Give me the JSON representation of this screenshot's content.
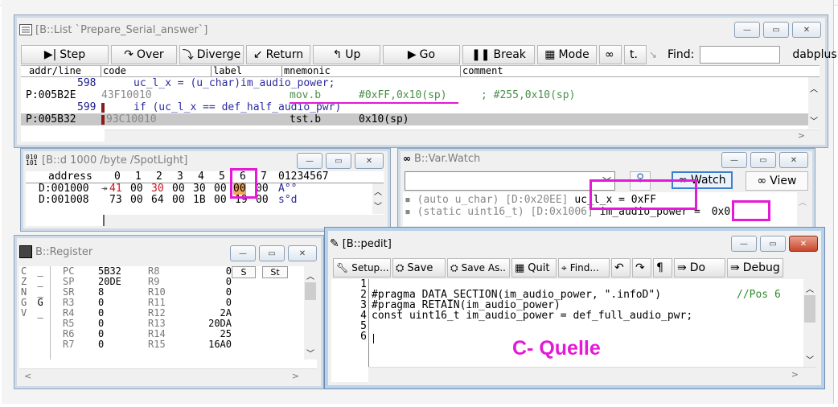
{
  "list_win": {
    "title": "[B::List `Prepare_Serial_answer`]",
    "toolbar": {
      "step": "Step",
      "over": "Over",
      "diverge": "Diverge",
      "return": "Return",
      "up": "Up",
      "go": "Go",
      "break": "Break",
      "mode": "Mode",
      "find_label": "Find:",
      "find_value": "",
      "file": "dabplus.c"
    },
    "columns": {
      "addr": "addr/line",
      "code": "code",
      "label": "label",
      "mnemonic": "mnemonic",
      "comment": "comment"
    },
    "rows": [
      {
        "addr": "598",
        "code": "",
        "src": "uc_l_x = (u_char)im_audio_power;",
        "mnem": "",
        "args": "",
        "comment": ""
      },
      {
        "addr": "P:005B2E",
        "code": "43F10010",
        "src": "",
        "mnem": "mov.b",
        "args": "#0xFF,0x10(sp)",
        "comment": "; #255,0x10(sp)"
      },
      {
        "addr": "599",
        "code": "",
        "src": "if (uc_l_x == def_half_audio_pwr)",
        "mnem": "",
        "args": "",
        "comment": ""
      },
      {
        "addr": "P:005B32",
        "code": "93C10010",
        "src": "",
        "mnem": "tst.b",
        "args": "0x10(sp)",
        "comment": ""
      }
    ]
  },
  "dump_win": {
    "title": "[B::d 1000 /byte /SpotLight]",
    "header": {
      "address": "address",
      "cols": [
        "0",
        "1",
        "2",
        "3",
        "4",
        "5",
        "6",
        "7"
      ],
      "ascii": "01234567"
    },
    "rows": [
      {
        "addr": "D:001000",
        "marker": "↠",
        "bytes": [
          "41",
          "00",
          "30",
          "00",
          "30",
          "00",
          "00",
          "00"
        ],
        "ascii": "A°°"
      },
      {
        "addr": "D:001008",
        "marker": "",
        "bytes": [
          "73",
          "00",
          "64",
          "00",
          "1B",
          "00",
          "19",
          "00"
        ],
        "ascii": "s°d"
      }
    ]
  },
  "var_win": {
    "title": "B::Var.Watch",
    "watch_label": "Watch",
    "view_label": "View",
    "lines": [
      {
        "prefix": "(auto u_char) [D:0x20EE]",
        "name": "uc_l_x",
        "value": "uc_l_x = 0xFF"
      },
      {
        "prefix": "(static uint16_t) [D:0x1006]",
        "name": "im_audio_power",
        "value": "im_audio_power = ",
        "val": "0x0"
      }
    ]
  },
  "reg_win": {
    "title": "B::Register",
    "flags": [
      [
        "C",
        "_"
      ],
      [
        "Z",
        "_"
      ],
      [
        "N",
        "_"
      ],
      [
        "G",
        "G"
      ],
      [
        "V",
        "_"
      ],
      [
        "",
        ""
      ],
      [
        "",
        ""
      ],
      [
        "",
        ""
      ]
    ],
    "regs": [
      [
        "PC",
        "5B32",
        "R8",
        "0"
      ],
      [
        "SP",
        "20DE",
        "R9",
        "0"
      ],
      [
        "SR",
        "8",
        "R10",
        "0"
      ],
      [
        "R3",
        "0",
        "R11",
        "0"
      ],
      [
        "R4",
        "0",
        "R12",
        "2A"
      ],
      [
        "R5",
        "0",
        "R13",
        "20DA"
      ],
      [
        "R6",
        "0",
        "R14",
        "25"
      ],
      [
        "R7",
        "0",
        "R15",
        "16A0"
      ]
    ],
    "btn_s": "S",
    "btn_st": "St"
  },
  "pedit_win": {
    "title": "[B::pedit]",
    "toolbar": {
      "setup": "Setup...",
      "save": "Save",
      "save_as": "Save As..",
      "quit": "Quit",
      "find": "Find...",
      "do": "Do",
      "debug": "Debug"
    },
    "lines": [
      {
        "n": "1",
        "text": ""
      },
      {
        "n": "2",
        "text": "#pragma DATA_SECTION(im_audio_power, \".infoD\")",
        "comment": "//Pos 6"
      },
      {
        "n": "3",
        "text": "#pragma RETAIN(im_audio_power)"
      },
      {
        "n": "4",
        "text": "const uint16_t im_audio_power = def_full_audio_pwr;"
      },
      {
        "n": "5",
        "text": ""
      },
      {
        "n": "6",
        "text": ""
      }
    ],
    "annotation": "C- Quelle"
  },
  "colors": {
    "highlight": "#e41ad5",
    "source_blue": "#2a2aa0",
    "disasm_olive": "#4a8f4a"
  }
}
